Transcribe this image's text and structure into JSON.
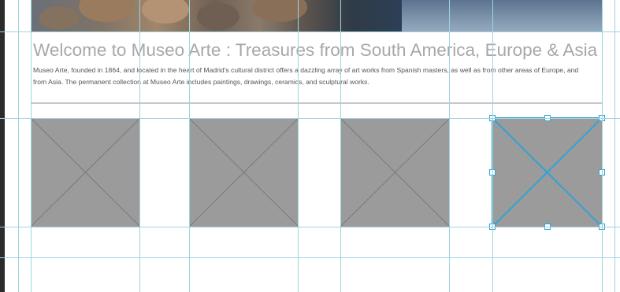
{
  "content": {
    "hero": {
      "description_icon": "hero-photo"
    },
    "heading": "Welcome to Museo Arte : Treasures from South America, Europe & Asia",
    "paragraph": "Museo Arte, founded in 1864, and located in the heart of Madrid's cultural district offers a dazzling array of art works from Spanish masters, as well as from other areas of Europe, and from Asia. The permanent collection at Museo Arte includes paintings, drawings, ceramics, and sculptural works.",
    "placeholders": [
      {
        "selected": false
      },
      {
        "selected": false
      },
      {
        "selected": false
      },
      {
        "selected": true
      }
    ]
  },
  "colors": {
    "guide": "#9ed4de",
    "selection": "#2ea3d8",
    "placeholder_fill": "#9b9b9b",
    "heading": "#a8a8a8"
  }
}
